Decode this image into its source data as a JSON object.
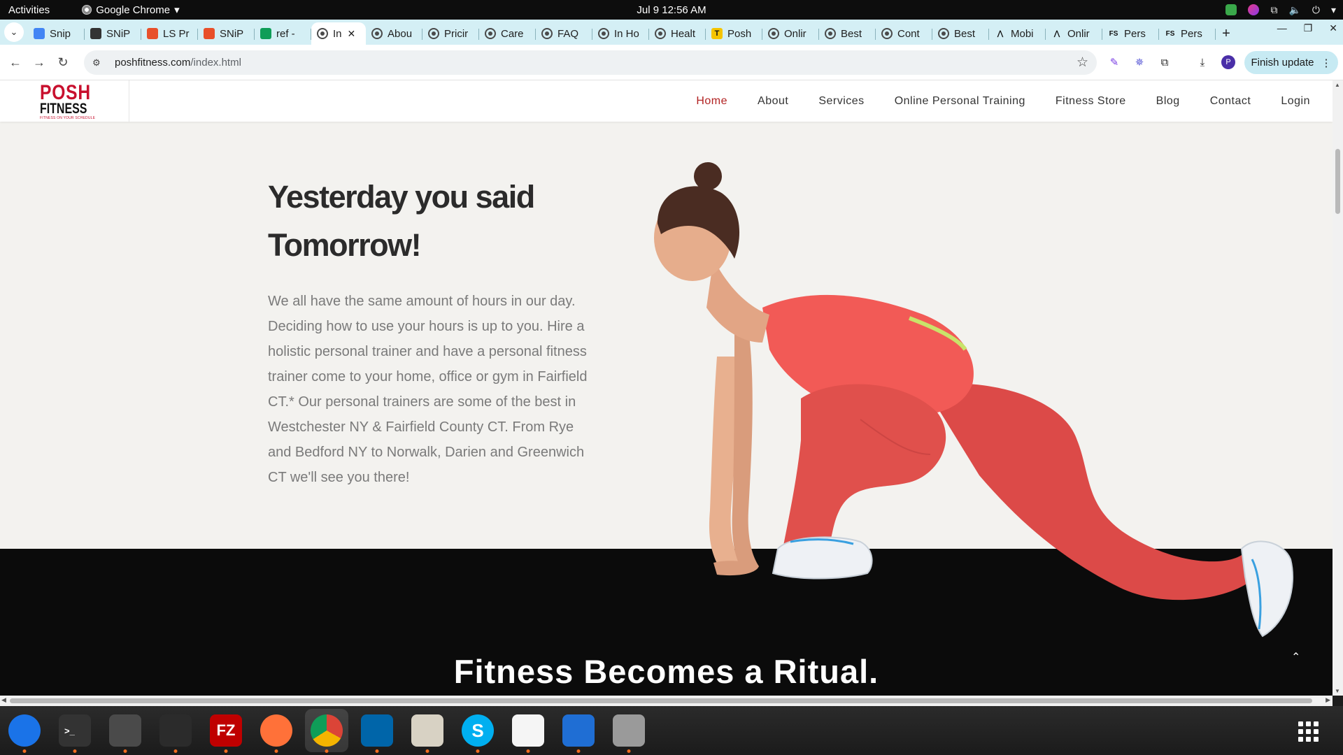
{
  "system": {
    "activities": "Activities",
    "app_name": "Google Chrome",
    "clock": "Jul 9  12:56 AM"
  },
  "tabs": [
    {
      "label": "Snip",
      "icon": "docs-icon",
      "color": "#4285f4"
    },
    {
      "label": "SNiP",
      "icon": "snip-icon",
      "color": "#333333"
    },
    {
      "label": "LS Pr",
      "icon": "ls-icon",
      "color": "#e8502a"
    },
    {
      "label": "SNiP",
      "icon": "snip2-icon",
      "color": "#e8502a"
    },
    {
      "label": "ref -",
      "icon": "sheets-icon",
      "color": "#0f9d58"
    },
    {
      "label": "In",
      "icon": "globe-icon",
      "active": true
    },
    {
      "label": "Abou",
      "icon": "globe-icon"
    },
    {
      "label": "Pricir",
      "icon": "globe-icon"
    },
    {
      "label": "Care",
      "icon": "globe-icon"
    },
    {
      "label": "FAQ",
      "icon": "globe-icon"
    },
    {
      "label": "In Ho",
      "icon": "globe-icon"
    },
    {
      "label": "Healt",
      "icon": "globe-icon"
    },
    {
      "label": "Posh",
      "icon": "posh-icon",
      "color": "#f5c400"
    },
    {
      "label": "Onlir",
      "icon": "globe-icon"
    },
    {
      "label": "Best",
      "icon": "globe-icon"
    },
    {
      "label": "Cont",
      "icon": "globe-icon"
    },
    {
      "label": "Best",
      "icon": "globe-icon"
    },
    {
      "label": "Mobi",
      "icon": "arch-icon"
    },
    {
      "label": "Onlir",
      "icon": "arch-icon"
    },
    {
      "label": "Pers",
      "icon": "fs-icon"
    },
    {
      "label": "Pers",
      "icon": "fs-icon"
    }
  ],
  "toolbar": {
    "url_host": "poshfitness.com",
    "url_path": "/index.html",
    "finish_update": "Finish update",
    "profile_initial": "P"
  },
  "site": {
    "logo_line1": "POSH",
    "logo_line2": "FITNESS",
    "logo_tagline": "FITNESS ON YOUR SCHEDULE",
    "nav": [
      "Home",
      "About",
      "Services",
      "Online Personal Training",
      "Fitness Store",
      "Blog",
      "Contact",
      "Login"
    ],
    "active_nav": "Home",
    "hero_title_line1": "Yesterday you said",
    "hero_title_line2": "Tomorrow!",
    "hero_text": "We all have the same amount of hours in our day. Deciding how to use your hours is up to you. Hire a holistic personal trainer and have a personal fitness trainer come to your home, office or gym in Fairfield CT.* Our personal trainers are some of the best in Westchester NY & Fairfield County CT. From Rye and Bedford NY to Norwalk, Darien and Greenwich CT we'll see you there!",
    "section_heading": "Fitness Becomes a Ritual."
  },
  "dock": [
    {
      "name": "thunderbird-icon",
      "color": "#1a73e8"
    },
    {
      "name": "terminal-icon",
      "color": "#333333"
    },
    {
      "name": "calculator-icon",
      "color": "#4a4a4a"
    },
    {
      "name": "system-monitor-icon",
      "color": "#2b2b2b"
    },
    {
      "name": "filezilla-icon",
      "color": "#bf0000"
    },
    {
      "name": "firefox-icon",
      "color": "#ff7139"
    },
    {
      "name": "chrome-icon",
      "color": "#4285f4"
    },
    {
      "name": "vscode-icon",
      "color": "#0065a9"
    },
    {
      "name": "files-icon",
      "color": "#d8d2c4"
    },
    {
      "name": "skype-icon",
      "color": "#00aff0"
    },
    {
      "name": "text-editor-icon",
      "color": "#f5f5f5"
    },
    {
      "name": "writer-icon",
      "color": "#1f6ed4"
    },
    {
      "name": "disk-icon",
      "color": "#9a9a9a"
    }
  ],
  "colors": {
    "brand_red": "#c8102e",
    "nav_active": "#b22222",
    "tab_strip": "#d4eff5",
    "hero_bg": "#f3f2ef"
  }
}
